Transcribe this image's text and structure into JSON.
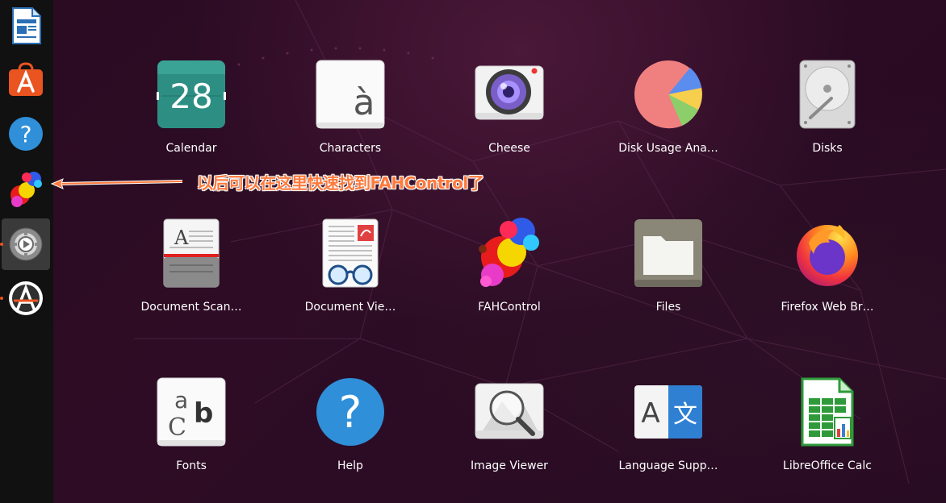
{
  "dock": {
    "items": [
      {
        "name": "libreoffice-writer-icon",
        "active": false,
        "running": false
      },
      {
        "name": "ubuntu-software-icon",
        "active": false,
        "running": false
      },
      {
        "name": "help-icon",
        "active": false,
        "running": false
      },
      {
        "name": "fahcontrol-icon",
        "active": false,
        "running": false
      },
      {
        "name": "settings-icon",
        "active": true,
        "running": true
      },
      {
        "name": "software-updater-icon",
        "active": false,
        "running": true
      }
    ]
  },
  "annotation": {
    "text": "以后可以在这里快速找到FAHControl了",
    "color": "#ff7a3c"
  },
  "apps": [
    {
      "label": "Calendar",
      "icon": "calendar-icon",
      "calendar_day": "28"
    },
    {
      "label": "Characters",
      "icon": "characters-icon",
      "glyph": "à"
    },
    {
      "label": "Cheese",
      "icon": "cheese-icon"
    },
    {
      "label": "Disk Usage Ana…",
      "icon": "disk-usage-analyzer-icon"
    },
    {
      "label": "Disks",
      "icon": "disks-icon"
    },
    {
      "label": "Document Scan…",
      "icon": "document-scanner-icon",
      "glyph": "A"
    },
    {
      "label": "Document Vie…",
      "icon": "document-viewer-icon"
    },
    {
      "label": "FAHControl",
      "icon": "fahcontrol-icon"
    },
    {
      "label": "Files",
      "icon": "files-icon"
    },
    {
      "label": "Firefox Web Br…",
      "icon": "firefox-icon"
    },
    {
      "label": "Fonts",
      "icon": "fonts-icon",
      "glyphs": [
        "a",
        "b",
        "C"
      ]
    },
    {
      "label": "Help",
      "icon": "help-icon",
      "glyph": "?"
    },
    {
      "label": "Image Viewer",
      "icon": "image-viewer-icon"
    },
    {
      "label": "Language Supp…",
      "icon": "language-support-icon",
      "glyphs": [
        "A",
        "文"
      ]
    },
    {
      "label": "LibreOffice Calc",
      "icon": "libreoffice-calc-icon"
    }
  ],
  "colors": {
    "accent": "#e95420",
    "dock_bg": "#111111",
    "background": "#2c0b24"
  }
}
